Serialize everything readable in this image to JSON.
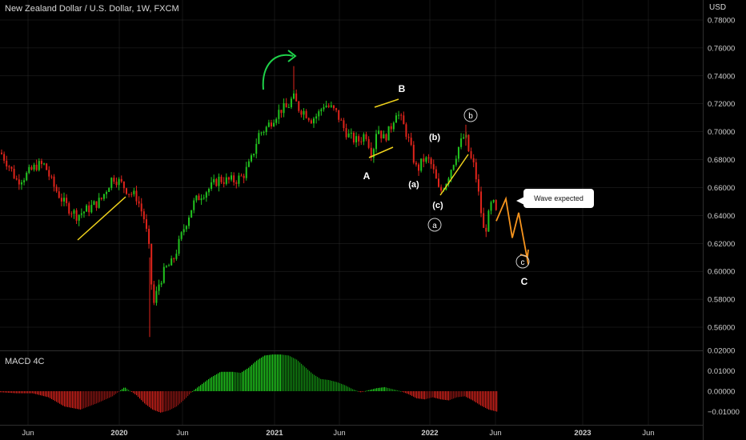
{
  "header": {
    "title": "New Zealand Dollar / U.S. Dollar, 1W, FXCM",
    "currency": "USD"
  },
  "macd": {
    "title": "MACD 4C",
    "ticks": [
      "0.02000",
      "0.01000",
      "0.00000",
      "−0.01000"
    ]
  },
  "annotations": {
    "callout": "Wave expected",
    "wave_A": "A",
    "wave_B": "B",
    "wave_C": "C",
    "sub_a": "(a)",
    "sub_b": "(b)",
    "sub_c": "(c)",
    "circle_a": "a",
    "circle_b": "b",
    "circle_c": "c"
  },
  "colors": {
    "up": "#22c31f",
    "down": "#e0241b",
    "wedge": "#f0d21c",
    "projection": "#f7941d",
    "arrow": "#1fd24a",
    "grid": "#2a2a2a"
  },
  "chart_data": {
    "type": "candlestick",
    "symbol": "New Zealand Dollar / U.S. Dollar",
    "interval": "1W",
    "source": "FXCM",
    "y_ticks": [
      "0.78000",
      "0.76000",
      "0.74000",
      "0.72000",
      "0.70000",
      "0.68000",
      "0.66000",
      "0.64000",
      "0.62000",
      "0.60000",
      "0.58000",
      "0.56000"
    ],
    "x_ticks": [
      "Jun",
      "2020",
      "Jun",
      "2021",
      "Jun",
      "2022",
      "Jun",
      "2023",
      "Jun"
    ],
    "ylim": [
      0.5445,
      0.7825
    ],
    "price_path": [
      [
        0,
        0.685
      ],
      [
        10,
        0.676
      ],
      [
        20,
        0.665
      ],
      [
        30,
        0.668
      ],
      [
        45,
        0.676
      ],
      [
        55,
        0.676
      ],
      [
        65,
        0.662
      ],
      [
        80,
        0.648
      ],
      [
        95,
        0.64
      ],
      [
        110,
        0.645
      ],
      [
        125,
        0.651
      ],
      [
        140,
        0.668
      ],
      [
        150,
        0.663
      ],
      [
        160,
        0.657
      ],
      [
        170,
        0.653
      ],
      [
        180,
        0.636
      ],
      [
        186,
        0.612
      ],
      [
        190,
        0.574
      ],
      [
        198,
        0.592
      ],
      [
        206,
        0.602
      ],
      [
        214,
        0.606
      ],
      [
        222,
        0.619
      ],
      [
        230,
        0.633
      ],
      [
        240,
        0.648
      ],
      [
        250,
        0.655
      ],
      [
        262,
        0.66
      ],
      [
        272,
        0.666
      ],
      [
        282,
        0.665
      ],
      [
        292,
        0.665
      ],
      [
        302,
        0.668
      ],
      [
        312,
        0.678
      ],
      [
        322,
        0.698
      ],
      [
        332,
        0.703
      ],
      [
        342,
        0.711
      ],
      [
        350,
        0.716
      ],
      [
        358,
        0.717
      ],
      [
        365,
        0.725
      ],
      [
        372,
        0.717
      ],
      [
        380,
        0.714
      ],
      [
        388,
        0.709
      ],
      [
        396,
        0.712
      ],
      [
        404,
        0.72
      ],
      [
        412,
        0.717
      ],
      [
        420,
        0.713
      ],
      [
        428,
        0.703
      ],
      [
        436,
        0.696
      ],
      [
        446,
        0.693
      ],
      [
        456,
        0.699
      ],
      [
        464,
        0.683
      ],
      [
        470,
        0.704
      ],
      [
        478,
        0.695
      ],
      [
        486,
        0.701
      ],
      [
        494,
        0.715
      ],
      [
        502,
        0.706
      ],
      [
        508,
        0.697
      ],
      [
        514,
        0.684
      ],
      [
        520,
        0.672
      ],
      [
        528,
        0.68
      ],
      [
        536,
        0.679
      ],
      [
        542,
        0.669
      ],
      [
        548,
        0.656
      ],
      [
        556,
        0.664
      ],
      [
        564,
        0.676
      ],
      [
        572,
        0.689
      ],
      [
        580,
        0.698
      ],
      [
        586,
        0.682
      ],
      [
        592,
        0.674
      ],
      [
        598,
        0.651
      ],
      [
        604,
        0.626
      ],
      [
        610,
        0.641
      ],
      [
        614,
        0.651
      ],
      [
        620,
        0.639
      ]
    ],
    "projection": [
      [
        620,
        0.636
      ],
      [
        632,
        0.652
      ],
      [
        640,
        0.624
      ],
      [
        648,
        0.642
      ],
      [
        660,
        0.605
      ]
    ],
    "macd_path": [
      [
        0,
        -0.0005
      ],
      [
        20,
        -0.001
      ],
      [
        40,
        -0.001
      ],
      [
        60,
        -0.003
      ],
      [
        80,
        -0.0075
      ],
      [
        100,
        -0.009
      ],
      [
        120,
        -0.006
      ],
      [
        140,
        -0.0025
      ],
      [
        155,
        0.002
      ],
      [
        170,
        -0.002
      ],
      [
        180,
        -0.006
      ],
      [
        190,
        -0.009
      ],
      [
        200,
        -0.0105
      ],
      [
        210,
        -0.0095
      ],
      [
        220,
        -0.0075
      ],
      [
        230,
        -0.004
      ],
      [
        240,
        0.0
      ],
      [
        250,
        0.003
      ],
      [
        262,
        0.0065
      ],
      [
        275,
        0.0095
      ],
      [
        290,
        0.0095
      ],
      [
        300,
        0.009
      ],
      [
        310,
        0.0115
      ],
      [
        320,
        0.015
      ],
      [
        330,
        0.0175
      ],
      [
        340,
        0.018
      ],
      [
        350,
        0.018
      ],
      [
        360,
        0.0175
      ],
      [
        370,
        0.0155
      ],
      [
        380,
        0.012
      ],
      [
        390,
        0.0085
      ],
      [
        400,
        0.006
      ],
      [
        410,
        0.0055
      ],
      [
        420,
        0.0045
      ],
      [
        430,
        0.003
      ],
      [
        440,
        0.001
      ],
      [
        450,
        -0.0005
      ],
      [
        460,
        0.0005
      ],
      [
        470,
        0.0015
      ],
      [
        480,
        0.002
      ],
      [
        490,
        0.001
      ],
      [
        500,
        0.0
      ],
      [
        510,
        -0.0015
      ],
      [
        520,
        -0.0035
      ],
      [
        530,
        -0.004
      ],
      [
        540,
        -0.003
      ],
      [
        550,
        -0.004
      ],
      [
        560,
        -0.0045
      ],
      [
        570,
        -0.003
      ],
      [
        580,
        -0.0025
      ],
      [
        590,
        -0.0045
      ],
      [
        600,
        -0.007
      ],
      [
        610,
        -0.009
      ],
      [
        620,
        -0.01
      ]
    ]
  }
}
